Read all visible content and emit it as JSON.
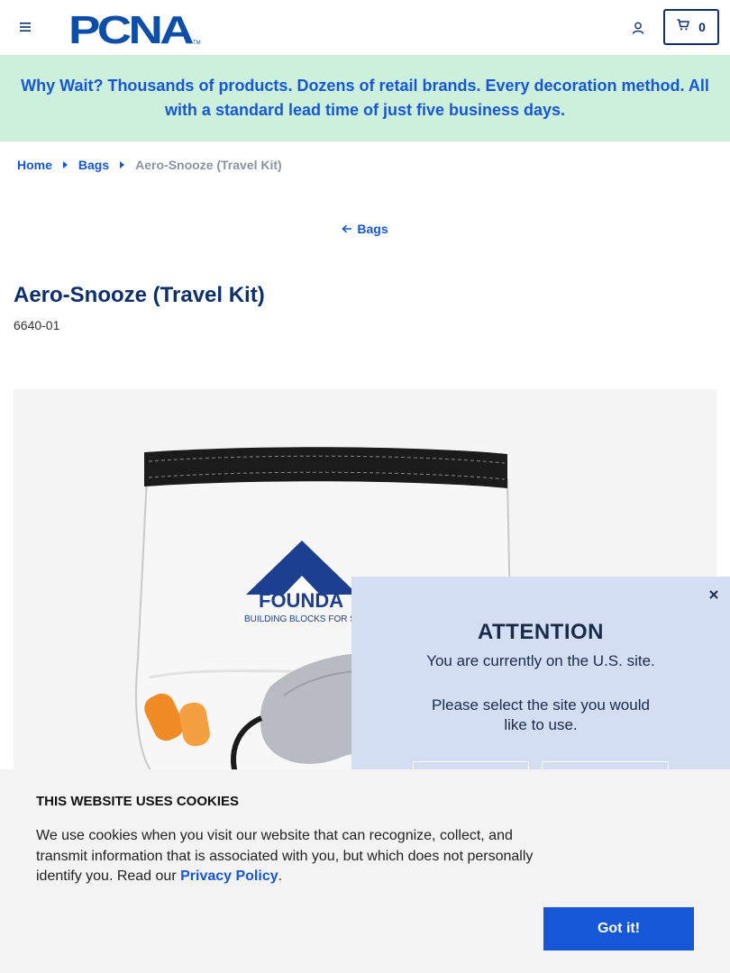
{
  "header": {
    "logo_text": "PCNA",
    "logo_tm": "TM",
    "cart_count": "0"
  },
  "promo": {
    "text": "Why Wait? Thousands of products. Dozens of retail brands. Every decoration method. All with a standard lead time of just five business days."
  },
  "breadcrumb": {
    "items": [
      "Home",
      "Bags"
    ],
    "current": "Aero-Snooze (Travel Kit)"
  },
  "back_link": {
    "label": "Bags"
  },
  "product": {
    "title": "Aero-Snooze (Travel Kit)",
    "sku": "6640-01",
    "image_logo_text": "FOUNDA",
    "image_tagline": "BUILDING BLOCKS FOR SUCCE"
  },
  "site_modal": {
    "heading": "ATTENTION",
    "line1": "You are currently on the U.S. site.",
    "line2": "Please select the site you would like to use."
  },
  "cookie_banner": {
    "title": "THIS WEBSITE USES COOKIES",
    "text": "We use cookies when you visit our website that can recognize, collect, and transmit information that is associated with you, but which does not personally identify you. Read our ",
    "link": "Privacy Policy",
    "text_end": ".",
    "button": "Got it!"
  },
  "colors": {
    "brand_navy": "#0d2f6e",
    "link_blue": "#1557d6",
    "promo_bg": "#cdf0dc",
    "modal_bg": "#d4def2"
  }
}
